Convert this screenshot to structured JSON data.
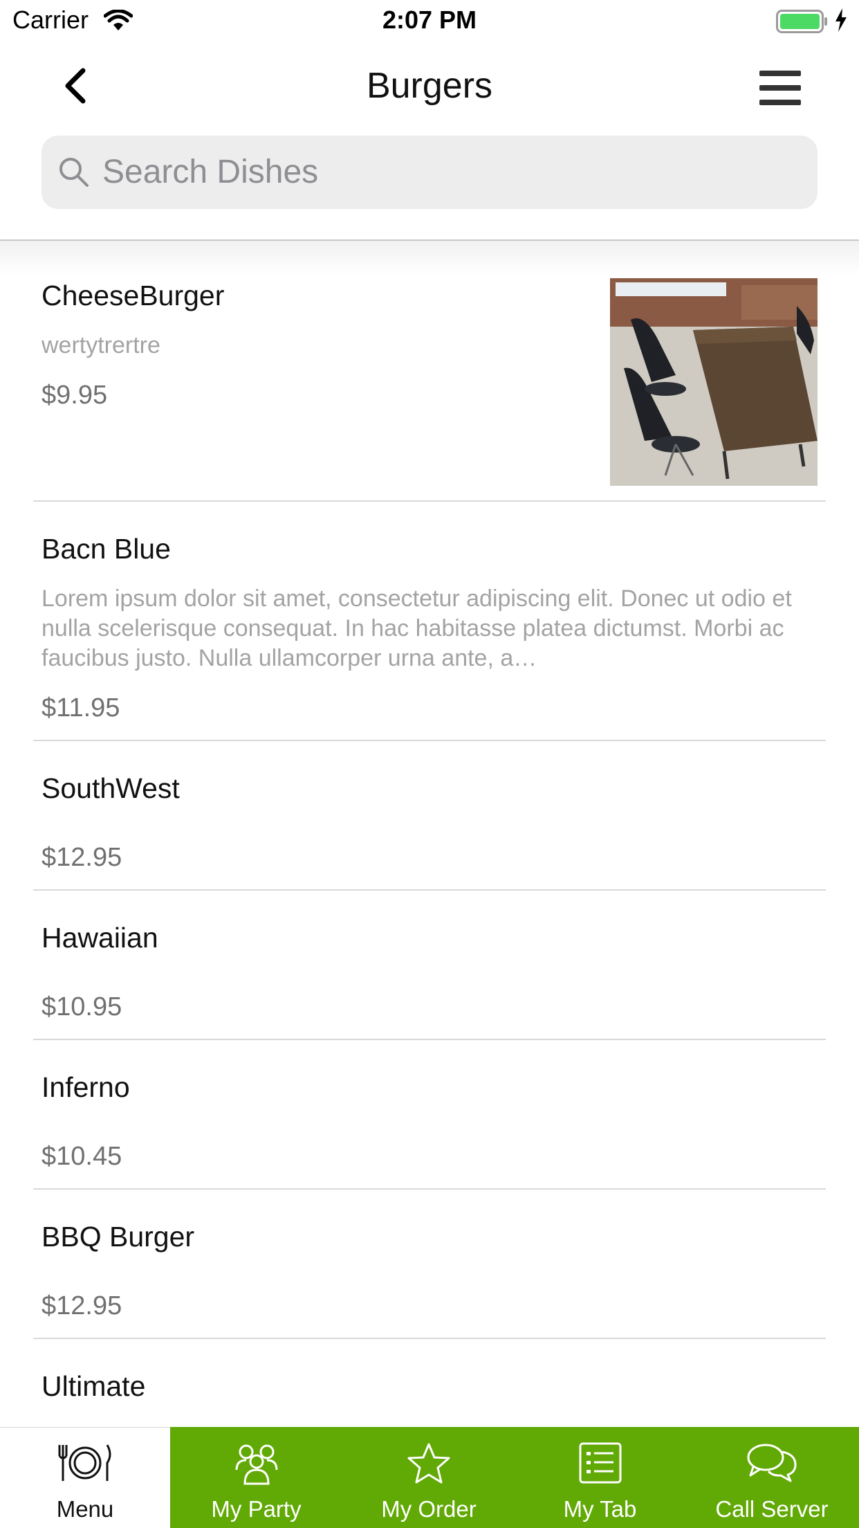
{
  "status_bar": {
    "carrier": "Carrier",
    "time": "2:07 PM"
  },
  "nav": {
    "title": "Burgers"
  },
  "search": {
    "placeholder": "Search Dishes"
  },
  "dishes": [
    {
      "name": "CheeseBurger",
      "description": "wertytrertre",
      "price": "$9.95",
      "has_photo": true
    },
    {
      "name": "Bacn Blue",
      "description": "Lorem ipsum dolor sit amet, consectetur adipiscing elit. Donec ut odio et nulla scelerisque consequat. In hac habitasse platea dictumst. Morbi ac faucibus justo. Nulla ullamcorper urna ante, a…",
      "price": "$11.95"
    },
    {
      "name": "SouthWest",
      "price": "$12.95"
    },
    {
      "name": "Hawaiian",
      "price": "$10.95"
    },
    {
      "name": "Inferno",
      "price": "$10.45"
    },
    {
      "name": "BBQ Burger",
      "price": "$12.95"
    },
    {
      "name": "Ultimate"
    }
  ],
  "tabs": [
    {
      "label": "Menu",
      "icon": "plate-cutlery-icon",
      "active": true
    },
    {
      "label": "My Party",
      "icon": "group-icon"
    },
    {
      "label": "My Order",
      "icon": "star-icon"
    },
    {
      "label": "My Tab",
      "icon": "list-icon"
    },
    {
      "label": "Call Server",
      "icon": "chat-bubbles-icon"
    }
  ],
  "colors": {
    "tab_bar_green": "#61a905",
    "battery_green": "#4cd964",
    "price_gray": "#707070",
    "description_gray": "#a3a3a3"
  }
}
